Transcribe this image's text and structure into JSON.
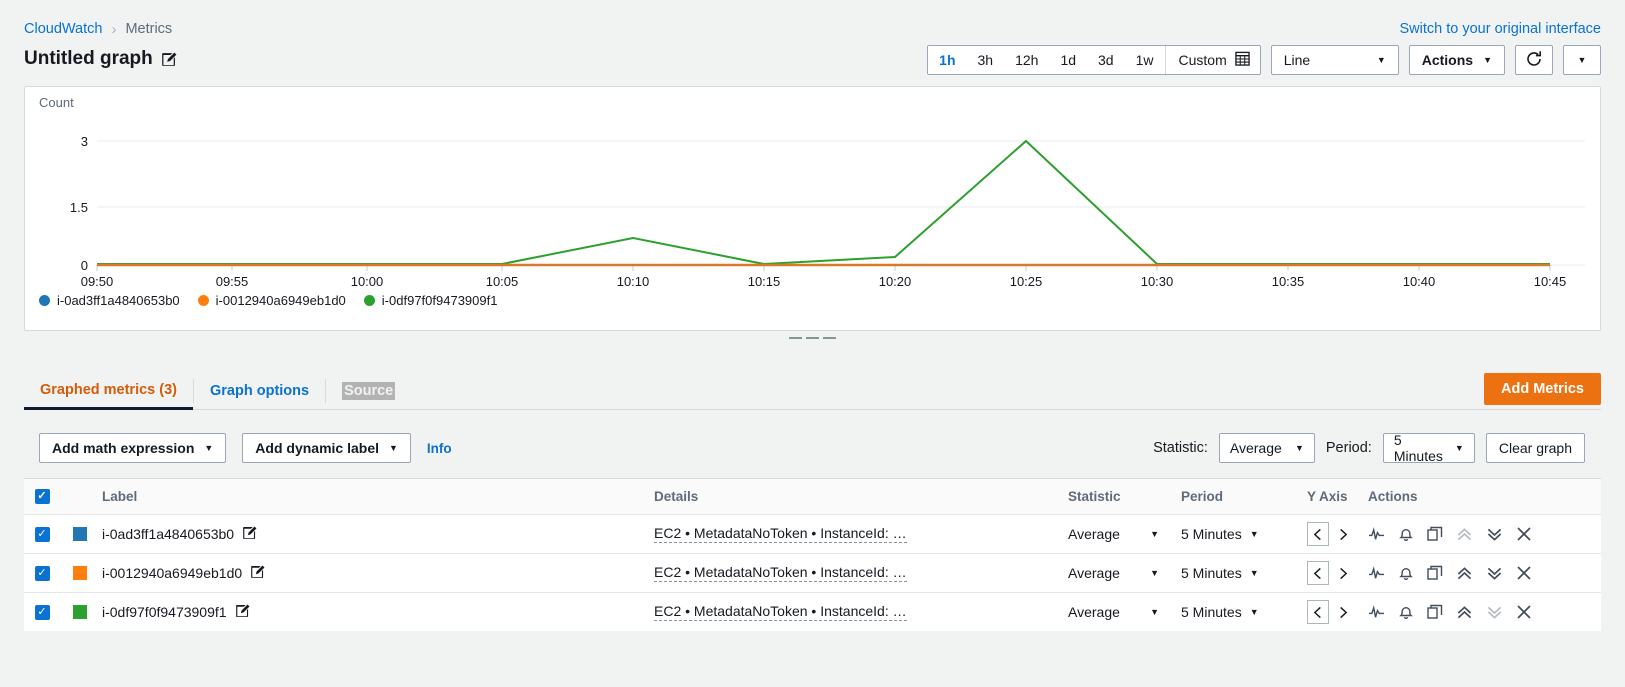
{
  "breadcrumb": {
    "root": "CloudWatch",
    "current": "Metrics",
    "separator": "›"
  },
  "switch_link": "Switch to your original interface",
  "graph": {
    "title": "Untitled graph",
    "edit_icon": "edit-pencil-icon"
  },
  "time_range": {
    "options": [
      "1h",
      "3h",
      "12h",
      "1d",
      "3d",
      "1w"
    ],
    "selected": "1h",
    "custom_label": "Custom",
    "custom_icon": "calendar-icon"
  },
  "chart_type": {
    "value": "Line"
  },
  "actions_button": {
    "label": "Actions"
  },
  "refresh": {
    "icon": "refresh-icon",
    "dropdown_icon": "chevron-down-icon"
  },
  "tabs": [
    {
      "label": "Graphed metrics (3)",
      "active": true
    },
    {
      "label": "Graph options",
      "active": false
    },
    {
      "label": "Source",
      "active": false,
      "selected_text": true
    }
  ],
  "add_metrics_label": "Add Metrics",
  "metric_toolbar": {
    "math_expression": "Add math expression",
    "dynamic_label": "Add dynamic label",
    "info": "Info",
    "statistic_label": "Statistic:",
    "statistic_value": "Average",
    "period_label": "Period:",
    "period_value": "5 Minutes",
    "clear_graph": "Clear graph"
  },
  "table": {
    "columns": [
      "Label",
      "Details",
      "Statistic",
      "Period",
      "Y Axis",
      "Actions"
    ],
    "header_checkbox": true,
    "rows": [
      {
        "checked": true,
        "color": "#1f77b4",
        "label": "i-0ad3ff1a4840653b0",
        "details": "EC2 • MetadataNoToken • InstanceId: …",
        "statistic": "Average",
        "period": "5 Minutes",
        "y_axis": "left",
        "move_up_enabled": false
      },
      {
        "checked": true,
        "color": "#ff7f0e",
        "label": "i-0012940a6949eb1d0",
        "details": "EC2 • MetadataNoToken • InstanceId: …",
        "statistic": "Average",
        "period": "5 Minutes",
        "y_axis": "left",
        "move_up_enabled": true
      },
      {
        "checked": true,
        "color": "#2ca02c",
        "label": "i-0df97f0f9473909f1",
        "details": "EC2 • MetadataNoToken • InstanceId: …",
        "statistic": "Average",
        "period": "5 Minutes",
        "y_axis": "left",
        "move_down_enabled": false
      }
    ],
    "row_action_icons": [
      "waveform-icon",
      "alarm-bell-icon",
      "duplicate-icon",
      "move-up-icon",
      "move-down-icon",
      "remove-icon"
    ]
  },
  "chart_data": {
    "type": "line",
    "title": "",
    "xlabel": "",
    "ylabel": "Count",
    "ylim": [
      0,
      3
    ],
    "yticks": [
      0,
      1.5,
      3
    ],
    "ytick_labels": [
      "0",
      "1.5",
      "3"
    ],
    "x": [
      "09:50",
      "09:55",
      "10:00",
      "10:05",
      "10:10",
      "10:15",
      "10:20",
      "10:25",
      "10:30",
      "10:35",
      "10:40",
      "10:45"
    ],
    "xtick_labels": [
      "09:50",
      "09:55",
      "10:00",
      "10:05",
      "10:10",
      "10:15",
      "10:20",
      "10:25",
      "10:30",
      "10:35",
      "10:40",
      "10:45"
    ],
    "grid": true,
    "legend_position": "bottom-left",
    "series": [
      {
        "name": "i-0ad3ff1a4840653b0",
        "color": "#1f77b4",
        "values": [
          0,
          0,
          0,
          0,
          0,
          0,
          0,
          0,
          0,
          0,
          0,
          0
        ]
      },
      {
        "name": "i-0012940a6949eb1d0",
        "color": "#ff7f0e",
        "values": [
          0,
          0,
          0,
          0,
          0,
          0,
          0,
          0,
          0,
          0,
          0,
          0
        ]
      },
      {
        "name": "i-0df97f0f9473909f1",
        "color": "#2ca02c",
        "values": [
          0,
          0,
          0,
          0,
          0.65,
          0,
          0.18,
          3,
          0,
          0,
          0,
          0
        ]
      }
    ]
  }
}
